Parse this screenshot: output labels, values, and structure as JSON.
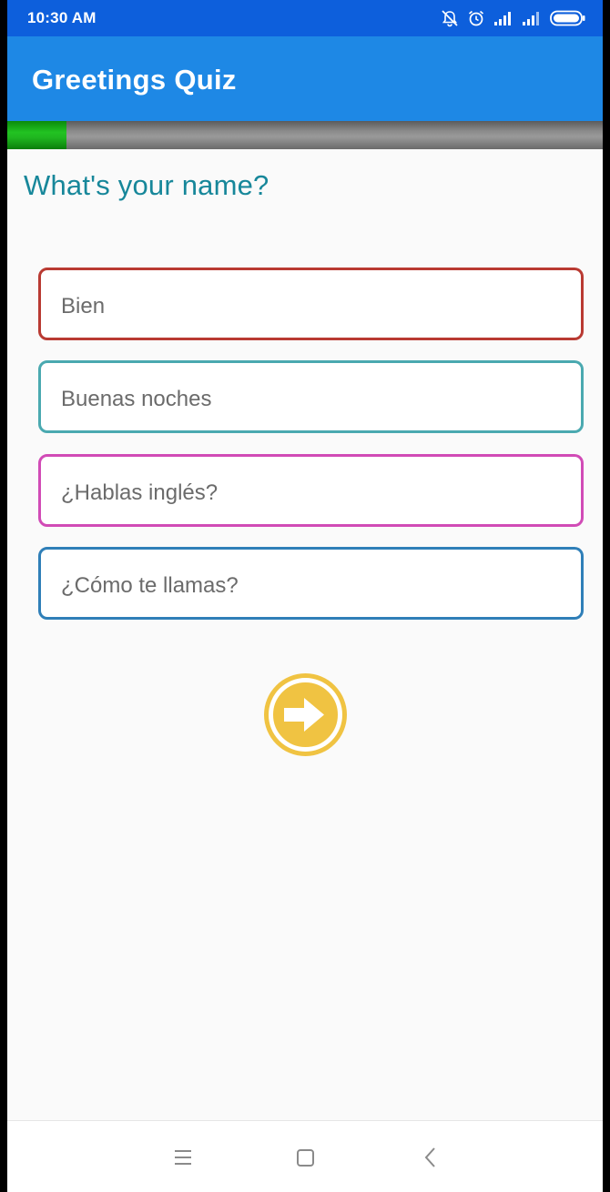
{
  "status_bar": {
    "time": "10:30 AM",
    "icons": [
      "notifications-off-icon",
      "alarm-icon",
      "signal-icon",
      "signal-icon",
      "battery-icon"
    ]
  },
  "app_bar": {
    "title": "Greetings Quiz"
  },
  "progress": {
    "fraction": 0.1,
    "fill_color": "#1fb51f"
  },
  "question": {
    "text": "What's your name?"
  },
  "options": [
    {
      "label": "Bien",
      "border_color": "#b93a32"
    },
    {
      "label": "Buenas noches",
      "border_color": "#4aa9b0"
    },
    {
      "label": "¿Hablas inglés?",
      "border_color": "#d14bb6"
    },
    {
      "label": "¿Cómo te llamas?",
      "border_color": "#2f7fb8"
    }
  ],
  "next_button": {
    "icon": "arrow-right-icon",
    "color": "#f0c342"
  },
  "nav_bar": {
    "icons": [
      "menu-icon",
      "home-square-icon",
      "back-chevron-icon"
    ]
  }
}
